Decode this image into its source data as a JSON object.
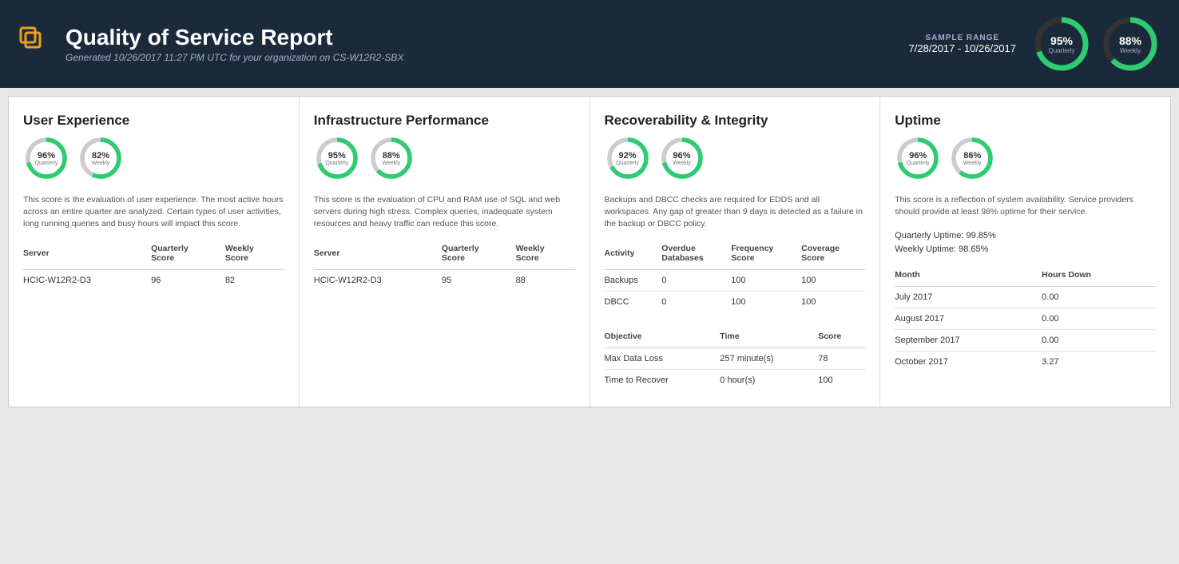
{
  "header": {
    "logo_alt": "Quality of Service Logo",
    "title": "Quality of Service Report",
    "generated": "Generated 10/26/2017 11:27 PM UTC for your organization on CS-W12R2-SBX",
    "sample_range_label": "SAMPLE RANGE",
    "sample_range_dates": "7/28/2017 - 10/26/2017",
    "quarterly_pct": "95%",
    "quarterly_label": "Quarterly",
    "weekly_pct": "88%",
    "weekly_label": "Weekly"
  },
  "user_experience": {
    "title": "User Experience",
    "desc": "This score is the evaluation of user experience. The most active hours across an entire quarter are analyzed. Certain types of user activities, long running queries and busy hours will impact this score.",
    "quarterly_pct": "96%",
    "quarterly_label": "Quarterly",
    "weekly_pct": "82%",
    "weekly_label": "Weekly",
    "table_headers": [
      "Server",
      "Quarterly Score",
      "Weekly Score"
    ],
    "table_rows": [
      {
        "server": "HCIC-W12R2-D3",
        "quarterly": "96",
        "weekly": "82"
      }
    ]
  },
  "infrastructure": {
    "title": "Infrastructure Performance",
    "desc": "This score is the evaluation of CPU and RAM use of SQL and web servers during high stress. Complex queries, inadequate system resources and heavy traffic can reduce this score.",
    "quarterly_pct": "95%",
    "quarterly_label": "Quarterly",
    "weekly_pct": "88%",
    "weekly_label": "Weekly",
    "table_headers": [
      "Server",
      "Quarterly Score",
      "Weekly Score"
    ],
    "table_rows": [
      {
        "server": "HCIC-W12R2-D3",
        "quarterly": "95",
        "weekly": "88"
      }
    ]
  },
  "recoverability": {
    "title": "Recoverability & Integrity",
    "desc": "Backups and DBCC checks are required for EDDS and all workspaces. Any gap of greater than 9 days is detected as a failure in the backup or DBCC policy.",
    "quarterly_pct": "92%",
    "quarterly_label": "Quarterly",
    "weekly_pct": "96%",
    "weekly_label": "Weekly",
    "activity_headers": [
      "Activity",
      "Overdue Databases",
      "Frequency Score",
      "Coverage Score"
    ],
    "activity_rows": [
      {
        "activity": "Backups",
        "overdue": "0",
        "frequency": "100",
        "coverage": "100"
      },
      {
        "activity": "DBCC",
        "overdue": "0",
        "frequency": "100",
        "coverage": "100"
      }
    ],
    "objective_headers": [
      "Objective",
      "Time",
      "Score"
    ],
    "objective_rows": [
      {
        "objective": "Max Data Loss",
        "time": "257 minute(s)",
        "score": "78"
      },
      {
        "objective": "Time to Recover",
        "time": "0 hour(s)",
        "score": "100"
      }
    ]
  },
  "uptime": {
    "title": "Uptime",
    "desc": "This score is a reflection of system availability. Service providers should provide at least 98% uptime for their service.",
    "quarterly_pct": "96%",
    "quarterly_label": "Quarterly",
    "weekly_pct": "86%",
    "weekly_label": "Weekly",
    "quarterly_uptime": "Quarterly Uptime: 99.85%",
    "weekly_uptime": "Weekly Uptime: 98.65%",
    "month_headers": [
      "Month",
      "Hours Down"
    ],
    "month_rows": [
      {
        "month": "July 2017",
        "hours": "0.00"
      },
      {
        "month": "August 2017",
        "hours": "0.00"
      },
      {
        "month": "September 2017",
        "hours": "0.00"
      },
      {
        "month": "October 2017",
        "hours": "3.27"
      }
    ]
  }
}
